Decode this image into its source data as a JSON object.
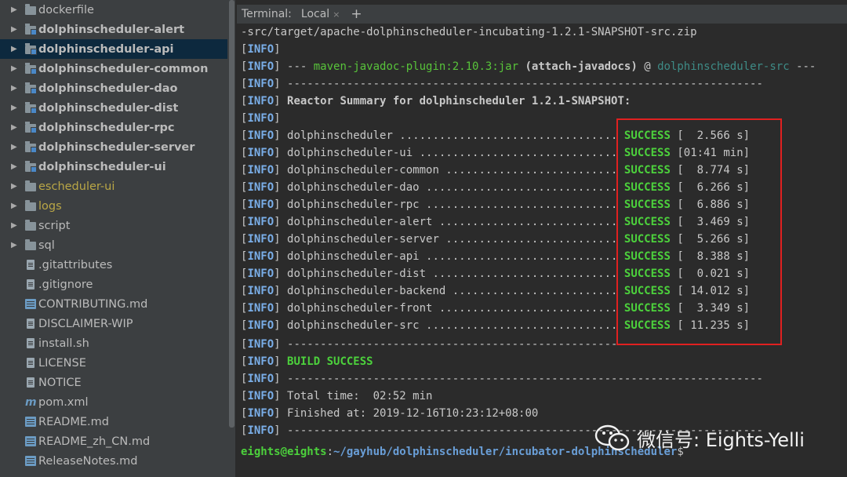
{
  "project_tree": {
    "items": [
      {
        "label": "dockerfile",
        "kind": "folder",
        "arrow": true
      },
      {
        "label": "dolphinscheduler-alert",
        "kind": "module",
        "arrow": true,
        "bold": true
      },
      {
        "label": "dolphinscheduler-api",
        "kind": "module",
        "arrow": true,
        "bold": true,
        "selected": true
      },
      {
        "label": "dolphinscheduler-common",
        "kind": "module",
        "arrow": true,
        "bold": true
      },
      {
        "label": "dolphinscheduler-dao",
        "kind": "module",
        "arrow": true,
        "bold": true
      },
      {
        "label": "dolphinscheduler-dist",
        "kind": "module",
        "arrow": true,
        "bold": true
      },
      {
        "label": "dolphinscheduler-rpc",
        "kind": "module",
        "arrow": true,
        "bold": true
      },
      {
        "label": "dolphinscheduler-server",
        "kind": "module",
        "arrow": true,
        "bold": true
      },
      {
        "label": "dolphinscheduler-ui",
        "kind": "module",
        "arrow": true,
        "bold": true
      },
      {
        "label": "escheduler-ui",
        "kind": "folder",
        "arrow": true,
        "excluded": true
      },
      {
        "label": "logs",
        "kind": "folder",
        "arrow": true,
        "excluded": true
      },
      {
        "label": "script",
        "kind": "folder",
        "arrow": true
      },
      {
        "label": "sql",
        "kind": "folder",
        "arrow": true
      },
      {
        "label": ".gitattributes",
        "kind": "file",
        "arrow": false
      },
      {
        "label": ".gitignore",
        "kind": "file",
        "arrow": false
      },
      {
        "label": "CONTRIBUTING.md",
        "kind": "md",
        "arrow": false
      },
      {
        "label": "DISCLAIMER-WIP",
        "kind": "file",
        "arrow": false
      },
      {
        "label": "install.sh",
        "kind": "file",
        "arrow": false
      },
      {
        "label": "LICENSE",
        "kind": "file",
        "arrow": false
      },
      {
        "label": "NOTICE",
        "kind": "file",
        "arrow": false
      },
      {
        "label": "pom.xml",
        "kind": "pom",
        "arrow": false
      },
      {
        "label": "README.md",
        "kind": "md",
        "arrow": false
      },
      {
        "label": "README_zh_CN.md",
        "kind": "md",
        "arrow": false
      },
      {
        "label": "ReleaseNotes.md",
        "kind": "md",
        "arrow": false
      }
    ]
  },
  "terminal": {
    "header_label": "Terminal:",
    "tab_label": "Local",
    "close_glyph": "×",
    "add_glyph": "+",
    "info_tag": "INFO",
    "lines": {
      "l0": "-src/target/apache-dolphinscheduler-incubating-1.2.1-SNAPSHOT-src.zip",
      "l2_prefix": " --- ",
      "l2_plugin": "maven-javadoc-plugin:2.10.3:jar",
      "l2_goal": " (attach-javadocs)",
      "l2_at": " @ ",
      "l2_project": "dolphinscheduler-src",
      "l2_suffix": " ---",
      "separator": " ------------------------------------------------------------------------",
      "reactor_summary": " Reactor Summary for dolphinscheduler 1.2.1-SNAPSHOT:",
      "build_success": " BUILD SUCCESS",
      "total_time": " Total time:  02:52 min",
      "finished_at": " Finished at: 2019-12-16T10:23:12+08:00"
    },
    "reactor": [
      {
        "module": " dolphinscheduler ................................. ",
        "status": "SUCCESS",
        "time": " [  2.566 s]"
      },
      {
        "module": " dolphinscheduler-ui .............................. ",
        "status": "SUCCESS",
        "time": " [01:41 min]"
      },
      {
        "module": " dolphinscheduler-common .......................... ",
        "status": "SUCCESS",
        "time": " [  8.774 s]"
      },
      {
        "module": " dolphinscheduler-dao ............................. ",
        "status": "SUCCESS",
        "time": " [  6.266 s]"
      },
      {
        "module": " dolphinscheduler-rpc ............................. ",
        "status": "SUCCESS",
        "time": " [  6.886 s]"
      },
      {
        "module": " dolphinscheduler-alert ........................... ",
        "status": "SUCCESS",
        "time": " [  3.469 s]"
      },
      {
        "module": " dolphinscheduler-server .......................... ",
        "status": "SUCCESS",
        "time": " [  5.266 s]"
      },
      {
        "module": " dolphinscheduler-api ............................. ",
        "status": "SUCCESS",
        "time": " [  8.388 s]"
      },
      {
        "module": " dolphinscheduler-dist ............................ ",
        "status": "SUCCESS",
        "time": " [  0.021 s]"
      },
      {
        "module": " dolphinscheduler-backend ......................... ",
        "status": "SUCCESS",
        "time": " [ 14.012 s]"
      },
      {
        "module": " dolphinscheduler-front ........................... ",
        "status": "SUCCESS",
        "time": " [  3.349 s]"
      },
      {
        "module": " dolphinscheduler-src ............................. ",
        "status": "SUCCESS",
        "time": " [ 11.235 s]"
      }
    ],
    "prompt": {
      "user_host": "eights@eights",
      "colon": ":",
      "path": "~/gayhub/dolphinscheduler/incubator-dolphinscheduler",
      "symbol": "$"
    }
  },
  "watermark": {
    "text": "微信号: Eights-Yelli"
  },
  "colors": {
    "info": "#7aaee8",
    "success": "#4cd13c",
    "highlight_box": "#e02020",
    "selected_row": "#0d293e"
  }
}
